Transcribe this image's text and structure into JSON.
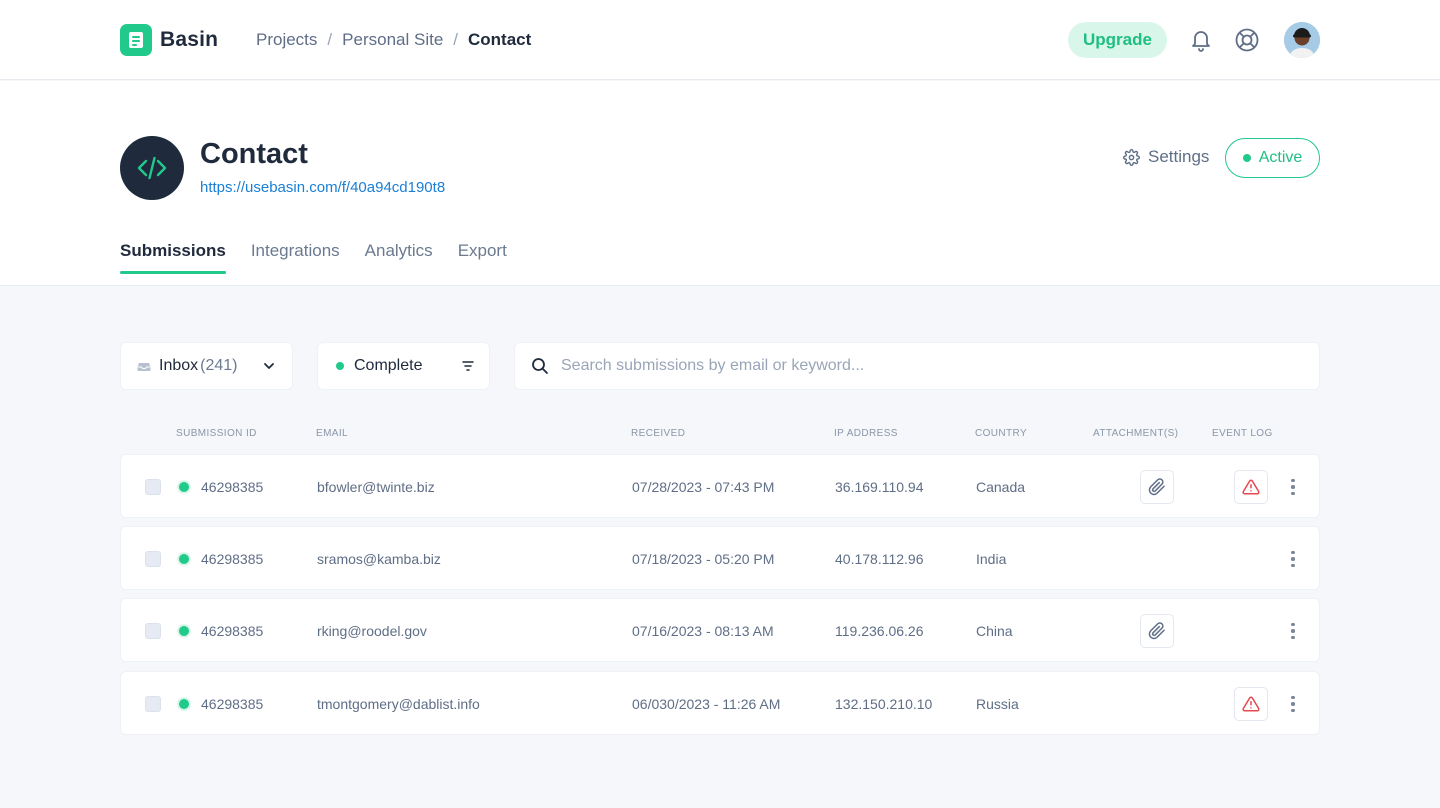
{
  "brand": {
    "name": "Basin",
    "accent": "#21c98b"
  },
  "breadcrumb": {
    "items": [
      "Projects",
      "Personal Site"
    ],
    "current": "Contact",
    "separator": "/"
  },
  "header": {
    "upgrade_label": "Upgrade",
    "icons": [
      "bell-icon",
      "help-lifebuoy-icon",
      "avatar"
    ]
  },
  "form": {
    "title": "Contact",
    "url": "https://usebasin.com/f/40a94cd190t8",
    "settings_label": "Settings",
    "status_label": "Active"
  },
  "tabs": [
    {
      "label": "Submissions",
      "selected": true
    },
    {
      "label": "Integrations",
      "selected": false
    },
    {
      "label": "Analytics",
      "selected": false
    },
    {
      "label": "Export",
      "selected": false
    }
  ],
  "toolbar": {
    "inbox_label": "Inbox",
    "inbox_count": "(241)",
    "status_filter": "Complete",
    "search_placeholder": "Search submissions by email or keyword..."
  },
  "table": {
    "columns": [
      "SUBMISSION ID",
      "EMAIL",
      "RECEIVED",
      "IP ADDRESS",
      "COUNTRY",
      "ATTACHMENT(S)",
      "EVENT LOG"
    ],
    "rows": [
      {
        "id": "46298385",
        "email": "bfowler@twinte.biz",
        "received": "07/28/2023 - 07:43 PM",
        "ip": "36.169.110.94",
        "country": "Canada",
        "attachment": true,
        "event_warning": true
      },
      {
        "id": "46298385",
        "email": "sramos@kamba.biz",
        "received": "07/18/2023 - 05:20 PM",
        "ip": "40.178.112.96",
        "country": "India",
        "attachment": false,
        "event_warning": false
      },
      {
        "id": "46298385",
        "email": "rking@roodel.gov",
        "received": "07/16/2023 - 08:13 AM",
        "ip": "119.236.06.26",
        "country": "China",
        "attachment": true,
        "event_warning": false
      },
      {
        "id": "46298385",
        "email": "tmontgomery@dablist.info",
        "received": "06/030/2023 - 11:26 AM",
        "ip": "132.150.210.10",
        "country": "Russia",
        "attachment": false,
        "event_warning": true
      }
    ]
  }
}
